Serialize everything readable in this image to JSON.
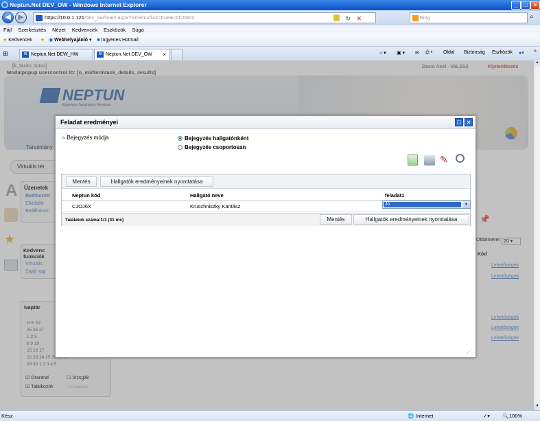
{
  "browser": {
    "title": "Neptun.Net DEV_OW - Windows Internet Explorer",
    "address_main": "https://10.0.1.121",
    "address_path": "/dev_ow/main.aspx?ismenuclick=true&ctrl=0802",
    "search_placeholder": "Bing",
    "menu": [
      "Fájl",
      "Szerkesztés",
      "Nézet",
      "Kedvencek",
      "Eszközök",
      "Súgó"
    ],
    "favorites_label": "Kedvencek",
    "fav_links": [
      "Webhelyajánló",
      "Ingyenes Hotmail"
    ],
    "tabs": [
      "Neptun.Net DEW_HW",
      "Neptun.Net DEV_OW"
    ],
    "toolbar_items": [
      "Oldal",
      "Biztonság",
      "Eszközök"
    ],
    "status_left": "Kész",
    "status_zone": "Internet",
    "zoom": "100%"
  },
  "under": {
    "user_label": "[k_tasks_tutor]",
    "control_label": "Modalpopup usercontrol ID: [o_midtermtask_details_results]",
    "user_right": "Dacsi Axel - V6LSS3",
    "logout": "Kijelentkezés",
    "logo": "NEPTUN",
    "logo_sub": "Egységes Tanulmányi Rendszer",
    "nav_left": "Tanulmány",
    "virtual_tab": "Virtuális tér",
    "messages_title": "Üzenetek",
    "messages_items": [
      "Beérkezett",
      "Elküldött",
      "Beállítások"
    ],
    "favorites_title": "Kedvenc funkciók",
    "fav_items": [
      "Virtuális",
      "Saját nap"
    ],
    "calendar_title": "Naptár",
    "cal_rows": [
      "H K Sz",
      "25 26 27",
      "1 2 3",
      "8 9 10",
      "15 16 17",
      "22 23 24 25 26 27 28",
      "29 30 1 2 3 4 5"
    ],
    "cal_checks": [
      "Órarend",
      "Vizsgák",
      "Találkozók",
      "Feladatok"
    ],
    "page_size_label": "Oldalméret",
    "page_size": "20",
    "kod_label": "Kód",
    "links": [
      "Lehetőségek",
      "Lehetőségek",
      "Lehetőségek",
      "Lehetőségek",
      "Lehetőségek"
    ]
  },
  "modal": {
    "title": "Feladat eredményei",
    "mode_label": "Bejegyzés módja",
    "option1": "Bejegyzés hallgatónként",
    "option2": "Bejegyzés csoportosan",
    "save": "Mentés",
    "print": "Hallgatók eredményeinek nyomtatása",
    "columns": [
      "Neptun kód",
      "Hallgató neve",
      "feladat1"
    ],
    "rows": [
      {
        "code": "CJOJ6X",
        "name": "Kruschniszky Kantász",
        "grade": "Jó"
      }
    ],
    "results_count": "Találatok száma:1/1 (31 ms)"
  }
}
